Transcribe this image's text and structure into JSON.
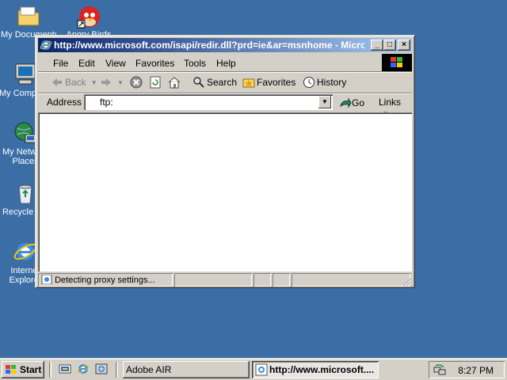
{
  "desktop": {
    "icons": [
      {
        "label": "My Documents",
        "icon": "folder-icon"
      },
      {
        "label": "Angry Birds",
        "icon": "angry-bird-icon"
      },
      {
        "label": "My Computer",
        "icon": "computer-icon"
      },
      {
        "label": "My Network Places",
        "icon": "network-icon"
      },
      {
        "label": "Recycle Bin",
        "icon": "recycle-bin-icon"
      },
      {
        "label": "Internet Explorer",
        "icon": "ie-icon"
      }
    ]
  },
  "window": {
    "title": "http://www.microsoft.com/isapi/redir.dll?prd=ie&ar=msnhome - Microsoft Internet Explorer",
    "menu": [
      "File",
      "Edit",
      "View",
      "Favorites",
      "Tools",
      "Help"
    ],
    "toolbar": {
      "back": "Back",
      "search": "Search",
      "favorites": "Favorites",
      "history": "History"
    },
    "address": {
      "label": "Address",
      "value": "ftp:",
      "go": "Go",
      "links": "Links"
    },
    "status": "Detecting proxy settings..."
  },
  "taskbar": {
    "start": "Start",
    "tasks": [
      "Adobe AIR",
      "http://www.microsoft...."
    ],
    "clock": "8:27 PM"
  },
  "colors": {
    "desktop": "#3a6ea5",
    "title_start": "#0a246a",
    "title_end": "#a6caf0",
    "face": "#d4d0c8"
  }
}
